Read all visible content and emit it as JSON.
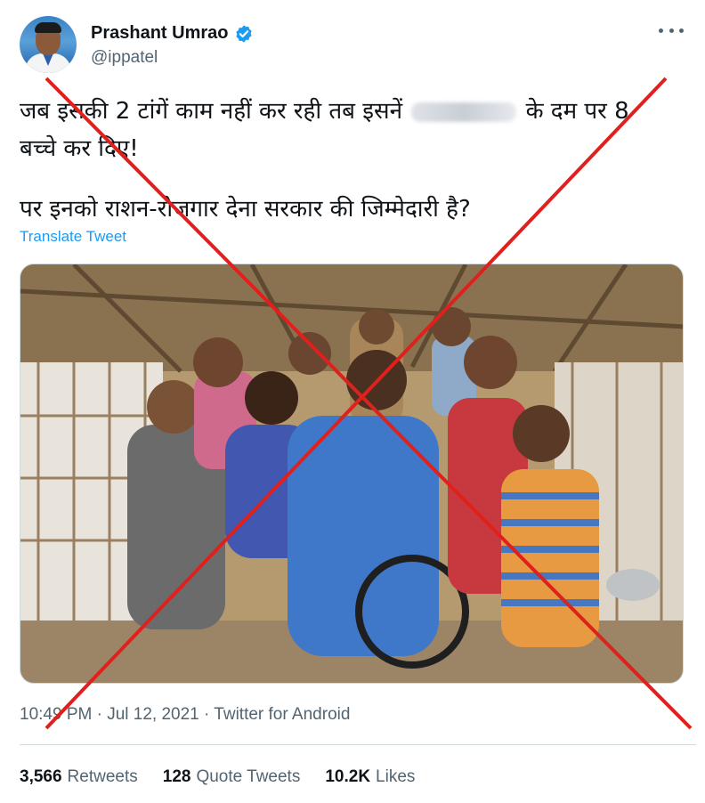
{
  "author": {
    "display_name": "Prashant Umrao",
    "handle": "@ippatel",
    "verified": true,
    "avatar_icon": "user-avatar"
  },
  "tweet": {
    "line1_start": "जब इसकी 2 टांगें काम नहीं कर रही तब इसनें",
    "line1_end": "के दम पर 8",
    "line2": "बच्चे कर दिए!",
    "line3": "पर इनको राशन-रोजगार देना सरकार की जिम्मेदारी है?",
    "translate_label": "Translate Tweet"
  },
  "meta": {
    "time": "10:49 PM",
    "separator": "·",
    "date": "Jul 12, 2021",
    "source": "Twitter for Android"
  },
  "stats": {
    "retweets_count": "3,566",
    "retweets_label": "Retweets",
    "quote_count": "128",
    "quote_label": "Quote Tweets",
    "likes_count": "10.2K",
    "likes_label": "Likes"
  },
  "colors": {
    "link": "#1d9bf0",
    "verified": "#1d9bf0",
    "cross": "#e0201c",
    "secondary_text": "#536471"
  },
  "icons": [
    "verified-badge-icon",
    "more-options-icon",
    "fact-check-cross-icon"
  ]
}
